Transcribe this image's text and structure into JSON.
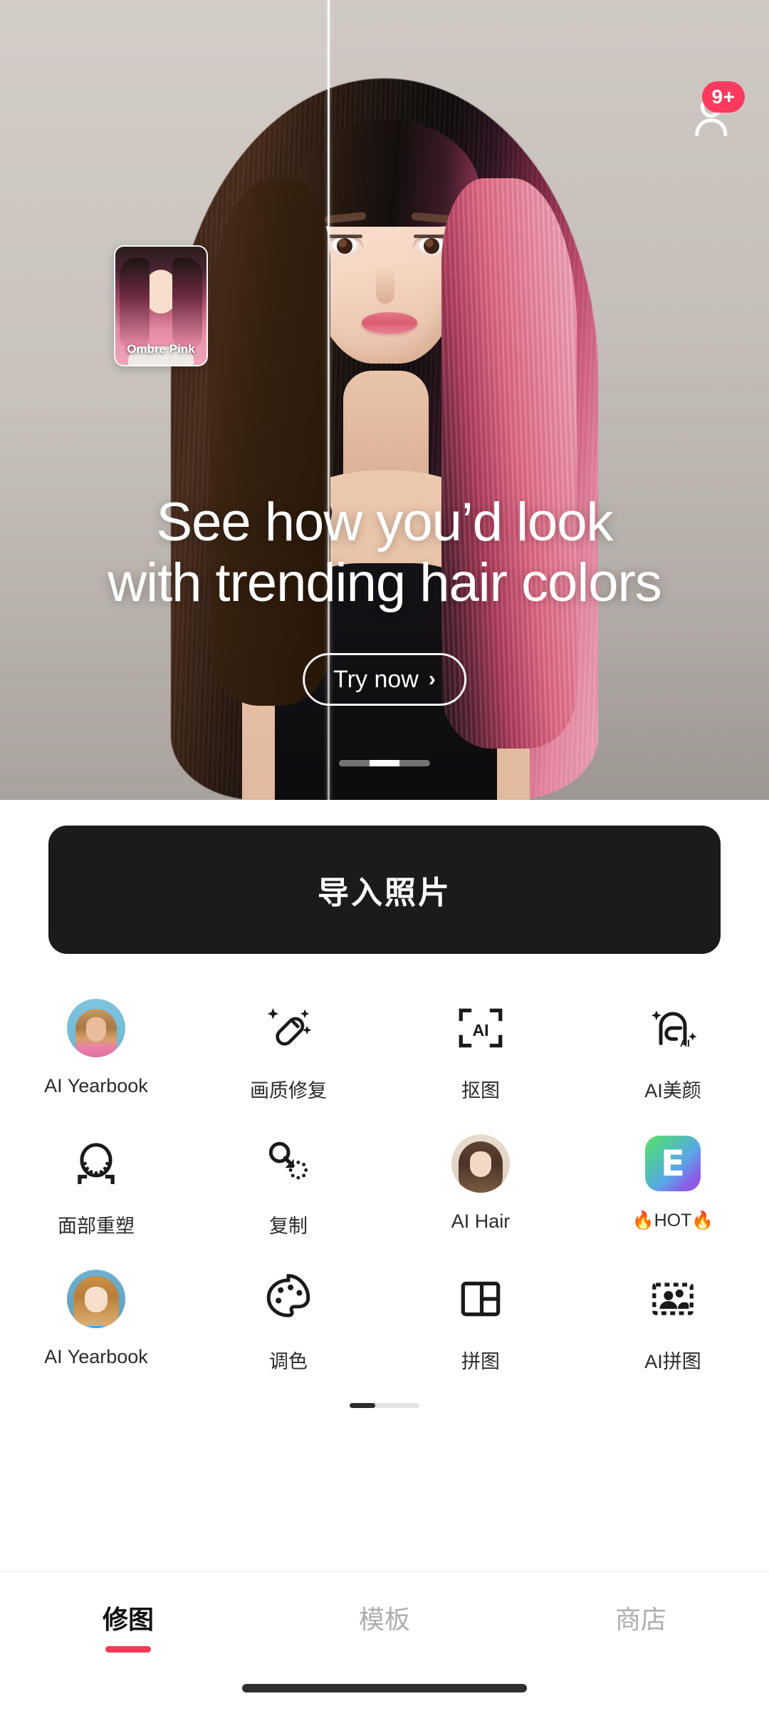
{
  "hero": {
    "headline_line1": "See how you’d look",
    "headline_line2": "with trending hair colors",
    "cta_label": "Try now",
    "cta_chevron": "›",
    "style_thumb_label": "Ombre Pink",
    "notification_badge": "9+",
    "pager": {
      "total": 3,
      "active_index": 1
    }
  },
  "import_button": {
    "label": "导入照片"
  },
  "tools": [
    {
      "label": "AI Yearbook",
      "icon": "photo-avatar-yearbook-icon"
    },
    {
      "label": "画质修复",
      "icon": "magic-wand-icon"
    },
    {
      "label": "抠图",
      "icon": "ai-cutout-frame-icon"
    },
    {
      "label": "AI美颜",
      "icon": "ai-face-beauty-icon"
    },
    {
      "label": "面部重塑",
      "icon": "face-reshape-icon"
    },
    {
      "label": "复制",
      "icon": "clone-stamp-icon"
    },
    {
      "label": "AI Hair",
      "icon": "photo-avatar-hair-icon"
    },
    {
      "label": "🔥HOT🔥",
      "icon": "gradient-app-icon"
    },
    {
      "label": "AI Yearbook",
      "icon": "photo-avatar-yearbook2-icon"
    },
    {
      "label": "调色",
      "icon": "palette-icon"
    },
    {
      "label": "拼图",
      "icon": "collage-grid-icon"
    },
    {
      "label": "AI拼图",
      "icon": "ai-collage-people-icon"
    }
  ],
  "grid_pager": {
    "total": 3,
    "active_index": 0
  },
  "bottom_nav": {
    "items": [
      {
        "label": "修图",
        "active": true
      },
      {
        "label": "模板",
        "active": false
      },
      {
        "label": "商店",
        "active": false
      }
    ],
    "accent_color": "#F5385A"
  },
  "hot_icon_glyph": "E"
}
